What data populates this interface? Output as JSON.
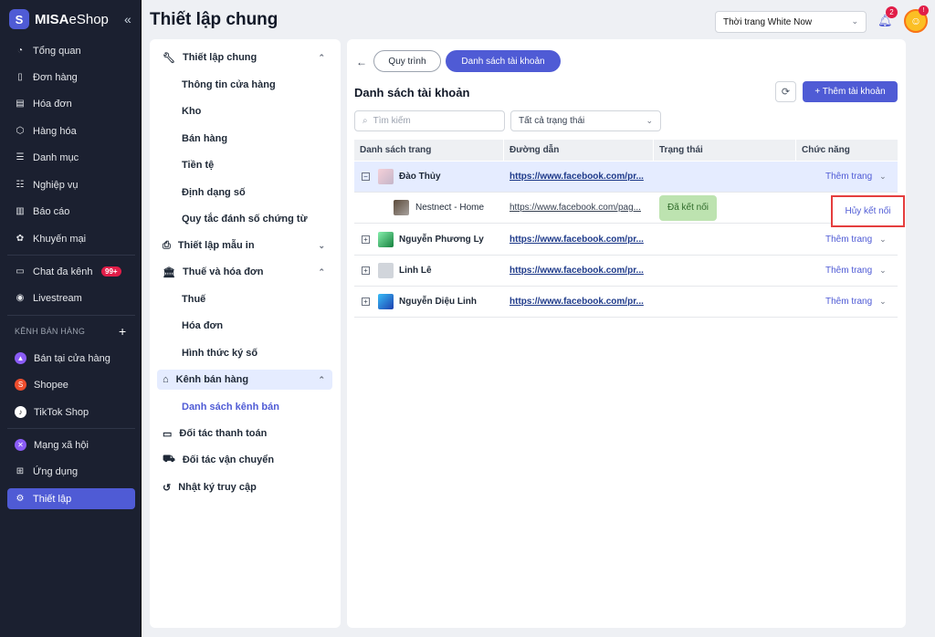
{
  "brand": {
    "bold": "MISA",
    "rest": "eShop"
  },
  "sidebar": {
    "items": [
      {
        "label": "Tổng quan",
        "icon": "dashboard-icon"
      },
      {
        "label": "Đơn hàng",
        "icon": "order-icon"
      },
      {
        "label": "Hóa đơn",
        "icon": "invoice-icon"
      },
      {
        "label": "Hàng hóa",
        "icon": "box-icon"
      },
      {
        "label": "Danh mục",
        "icon": "list-icon"
      },
      {
        "label": "Nghiệp vụ",
        "icon": "operations-icon"
      },
      {
        "label": "Báo cáo",
        "icon": "report-icon"
      },
      {
        "label": "Khuyến mại",
        "icon": "gift-icon"
      },
      {
        "label": "Chat đa kênh",
        "icon": "chat-icon"
      },
      {
        "label": "Livestream",
        "icon": "livestream-icon"
      }
    ],
    "chat_badge": "99+",
    "section_label": "KÊNH BÁN HÀNG",
    "channels": [
      {
        "label": "Bán tại cửa hàng",
        "color": "#8b5cf6"
      },
      {
        "label": "Shopee",
        "color": "#ee4d2d"
      },
      {
        "label": "TikTok Shop",
        "color": "#111111"
      }
    ],
    "bottom": [
      {
        "label": "Mạng xã hội"
      },
      {
        "label": "Ứng dụng"
      },
      {
        "label": "Thiết lập"
      }
    ]
  },
  "header": {
    "title": "Thiết lập chung",
    "store": "Thời trang White Now",
    "bell_count": "2",
    "avatar_badge": "!"
  },
  "settings_menu": {
    "group1": "Thiết lập chung",
    "group1_items": [
      "Thông tin cửa hàng",
      "Kho",
      "Bán hàng",
      "Tiền tệ",
      "Định dạng số",
      "Quy tắc đánh số chứng từ"
    ],
    "group2": "Thiết lập mẫu in",
    "group3": "Thuế và hóa đơn",
    "group3_items": [
      "Thuế",
      "Hóa đơn",
      "Hình thức ký số"
    ],
    "group4": "Kênh bán hàng",
    "group4_items": [
      "Danh sách kênh bán"
    ],
    "group5": "Đối tác thanh toán",
    "group6": "Đối tác vận chuyển",
    "group7": "Nhật ký truy cập"
  },
  "main": {
    "tab_process": "Quy trình",
    "tab_accounts": "Danh sách tài khoản",
    "title": "Danh sách tài khoản",
    "add_button": "+ Thêm tài khoản",
    "search_placeholder": "Tìm kiếm",
    "status_filter": "Tất cả trạng thái",
    "columns": [
      "Danh sách trang",
      "Đường dẫn",
      "Trạng thái",
      "Chức năng"
    ],
    "rows": [
      {
        "name": "Đào Thủy",
        "link": "https://www.facebook.com/pr...",
        "action": "Thêm trang",
        "expanded": true
      },
      {
        "name": "Nestnect - Home",
        "link": "https://www.facebook.com/pag...",
        "status": "Đã kết nối",
        "action": "Hủy kết nối",
        "child": true
      },
      {
        "name": "Nguyễn Phương Ly",
        "link": "https://www.facebook.com/pr...",
        "action": "Thêm trang"
      },
      {
        "name": "Linh Lê",
        "link": "https://www.facebook.com/pr...",
        "action": "Thêm trang"
      },
      {
        "name": "Nguyễn Diệu Linh",
        "link": "https://www.facebook.com/pr...",
        "action": "Thêm trang"
      }
    ]
  }
}
